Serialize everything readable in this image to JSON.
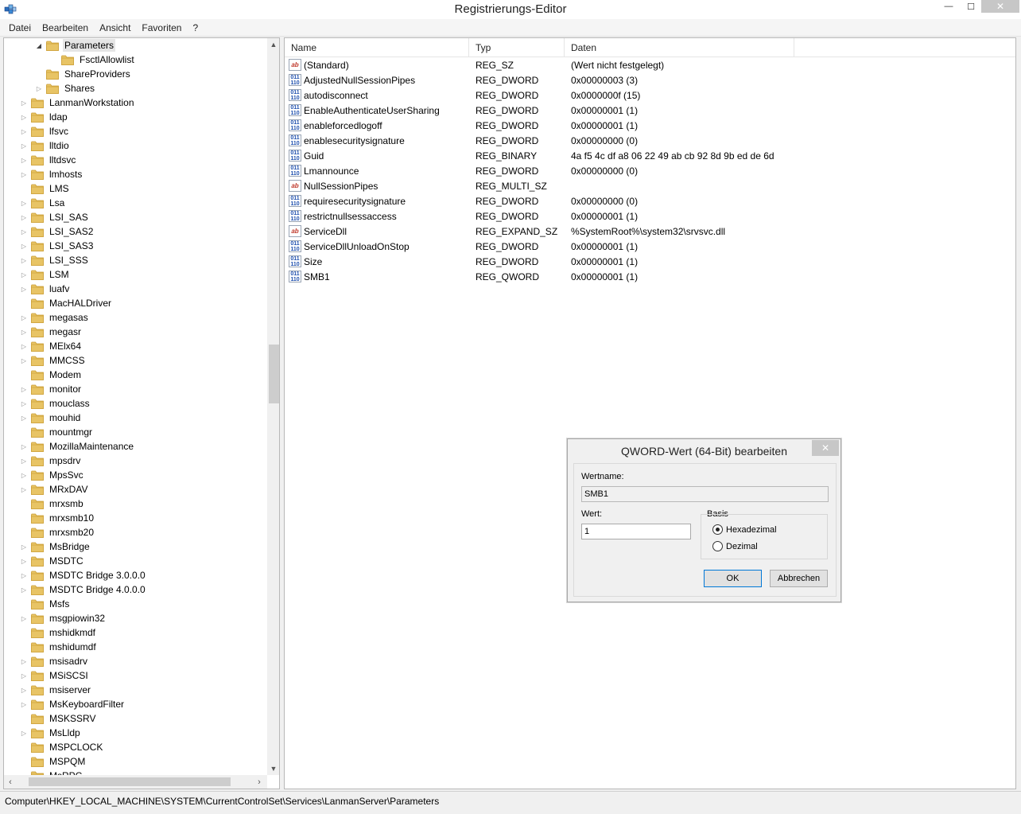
{
  "window": {
    "title": "Registrierungs-Editor",
    "minimize_glyph": "—",
    "maximize_glyph": "☐",
    "close_glyph": "✕"
  },
  "menu": [
    "Datei",
    "Bearbeiten",
    "Ansicht",
    "Favoriten",
    "?"
  ],
  "tree": {
    "items": [
      {
        "label": "Parameters",
        "indent": 2,
        "expander": "open",
        "selected": true
      },
      {
        "label": "FsctlAllowlist",
        "indent": 3,
        "expander": "none",
        "selected": false
      },
      {
        "label": "ShareProviders",
        "indent": 2,
        "expander": "none",
        "selected": false
      },
      {
        "label": "Shares",
        "indent": 2,
        "expander": "closed",
        "selected": false
      },
      {
        "label": "LanmanWorkstation",
        "indent": 1,
        "expander": "closed",
        "selected": false
      },
      {
        "label": "ldap",
        "indent": 1,
        "expander": "closed",
        "selected": false
      },
      {
        "label": "lfsvc",
        "indent": 1,
        "expander": "closed",
        "selected": false
      },
      {
        "label": "lltdio",
        "indent": 1,
        "expander": "closed",
        "selected": false
      },
      {
        "label": "lltdsvc",
        "indent": 1,
        "expander": "closed",
        "selected": false
      },
      {
        "label": "lmhosts",
        "indent": 1,
        "expander": "closed",
        "selected": false
      },
      {
        "label": "LMS",
        "indent": 1,
        "expander": "none",
        "selected": false
      },
      {
        "label": "Lsa",
        "indent": 1,
        "expander": "closed",
        "selected": false
      },
      {
        "label": "LSI_SAS",
        "indent": 1,
        "expander": "closed",
        "selected": false
      },
      {
        "label": "LSI_SAS2",
        "indent": 1,
        "expander": "closed",
        "selected": false
      },
      {
        "label": "LSI_SAS3",
        "indent": 1,
        "expander": "closed",
        "selected": false
      },
      {
        "label": "LSI_SSS",
        "indent": 1,
        "expander": "closed",
        "selected": false
      },
      {
        "label": "LSM",
        "indent": 1,
        "expander": "closed",
        "selected": false
      },
      {
        "label": "luafv",
        "indent": 1,
        "expander": "closed",
        "selected": false
      },
      {
        "label": "MacHALDriver",
        "indent": 1,
        "expander": "none",
        "selected": false
      },
      {
        "label": "megasas",
        "indent": 1,
        "expander": "closed",
        "selected": false
      },
      {
        "label": "megasr",
        "indent": 1,
        "expander": "closed",
        "selected": false
      },
      {
        "label": "MElx64",
        "indent": 1,
        "expander": "closed",
        "selected": false
      },
      {
        "label": "MMCSS",
        "indent": 1,
        "expander": "closed",
        "selected": false
      },
      {
        "label": "Modem",
        "indent": 1,
        "expander": "none",
        "selected": false
      },
      {
        "label": "monitor",
        "indent": 1,
        "expander": "closed",
        "selected": false
      },
      {
        "label": "mouclass",
        "indent": 1,
        "expander": "closed",
        "selected": false
      },
      {
        "label": "mouhid",
        "indent": 1,
        "expander": "closed",
        "selected": false
      },
      {
        "label": "mountmgr",
        "indent": 1,
        "expander": "none",
        "selected": false
      },
      {
        "label": "MozillaMaintenance",
        "indent": 1,
        "expander": "closed",
        "selected": false
      },
      {
        "label": "mpsdrv",
        "indent": 1,
        "expander": "closed",
        "selected": false
      },
      {
        "label": "MpsSvc",
        "indent": 1,
        "expander": "closed",
        "selected": false
      },
      {
        "label": "MRxDAV",
        "indent": 1,
        "expander": "closed",
        "selected": false
      },
      {
        "label": "mrxsmb",
        "indent": 1,
        "expander": "none",
        "selected": false
      },
      {
        "label": "mrxsmb10",
        "indent": 1,
        "expander": "none",
        "selected": false
      },
      {
        "label": "mrxsmb20",
        "indent": 1,
        "expander": "none",
        "selected": false
      },
      {
        "label": "MsBridge",
        "indent": 1,
        "expander": "closed",
        "selected": false
      },
      {
        "label": "MSDTC",
        "indent": 1,
        "expander": "closed",
        "selected": false
      },
      {
        "label": "MSDTC Bridge 3.0.0.0",
        "indent": 1,
        "expander": "closed",
        "selected": false
      },
      {
        "label": "MSDTC Bridge 4.0.0.0",
        "indent": 1,
        "expander": "closed",
        "selected": false
      },
      {
        "label": "Msfs",
        "indent": 1,
        "expander": "none",
        "selected": false
      },
      {
        "label": "msgpiowin32",
        "indent": 1,
        "expander": "closed",
        "selected": false
      },
      {
        "label": "mshidkmdf",
        "indent": 1,
        "expander": "none",
        "selected": false
      },
      {
        "label": "mshidumdf",
        "indent": 1,
        "expander": "none",
        "selected": false
      },
      {
        "label": "msisadrv",
        "indent": 1,
        "expander": "closed",
        "selected": false
      },
      {
        "label": "MSiSCSI",
        "indent": 1,
        "expander": "closed",
        "selected": false
      },
      {
        "label": "msiserver",
        "indent": 1,
        "expander": "closed",
        "selected": false
      },
      {
        "label": "MsKeyboardFilter",
        "indent": 1,
        "expander": "closed",
        "selected": false
      },
      {
        "label": "MSKSSRV",
        "indent": 1,
        "expander": "none",
        "selected": false
      },
      {
        "label": "MsLldp",
        "indent": 1,
        "expander": "closed",
        "selected": false
      },
      {
        "label": "MSPCLOCK",
        "indent": 1,
        "expander": "none",
        "selected": false
      },
      {
        "label": "MSPQM",
        "indent": 1,
        "expander": "none",
        "selected": false
      },
      {
        "label": "MsRPC",
        "indent": 1,
        "expander": "none",
        "selected": false
      }
    ],
    "scroll_up_glyph": "▲",
    "scroll_down_glyph": "▼",
    "scroll_left_glyph": "‹",
    "scroll_right_glyph": "›"
  },
  "list": {
    "columns": [
      "Name",
      "Typ",
      "Daten"
    ],
    "rows": [
      {
        "icon": "string-value-icon",
        "name": "(Standard)",
        "type": "REG_SZ",
        "data": "(Wert nicht festgelegt)"
      },
      {
        "icon": "binary-value-icon",
        "name": "AdjustedNullSessionPipes",
        "type": "REG_DWORD",
        "data": "0x00000003 (3)"
      },
      {
        "icon": "binary-value-icon",
        "name": "autodisconnect",
        "type": "REG_DWORD",
        "data": "0x0000000f (15)"
      },
      {
        "icon": "binary-value-icon",
        "name": "EnableAuthenticateUserSharing",
        "type": "REG_DWORD",
        "data": "0x00000001 (1)"
      },
      {
        "icon": "binary-value-icon",
        "name": "enableforcedlogoff",
        "type": "REG_DWORD",
        "data": "0x00000001 (1)"
      },
      {
        "icon": "binary-value-icon",
        "name": "enablesecuritysignature",
        "type": "REG_DWORD",
        "data": "0x00000000 (0)"
      },
      {
        "icon": "binary-value-icon",
        "name": "Guid",
        "type": "REG_BINARY",
        "data": "4a f5 4c df a8 06 22 49 ab cb 92 8d 9b ed de 6d"
      },
      {
        "icon": "binary-value-icon",
        "name": "Lmannounce",
        "type": "REG_DWORD",
        "data": "0x00000000 (0)"
      },
      {
        "icon": "string-value-icon",
        "name": "NullSessionPipes",
        "type": "REG_MULTI_SZ",
        "data": ""
      },
      {
        "icon": "binary-value-icon",
        "name": "requiresecuritysignature",
        "type": "REG_DWORD",
        "data": "0x00000000 (0)"
      },
      {
        "icon": "binary-value-icon",
        "name": "restrictnullsessaccess",
        "type": "REG_DWORD",
        "data": "0x00000001 (1)"
      },
      {
        "icon": "string-value-icon",
        "name": "ServiceDll",
        "type": "REG_EXPAND_SZ",
        "data": "%SystemRoot%\\system32\\srvsvc.dll"
      },
      {
        "icon": "binary-value-icon",
        "name": "ServiceDllUnloadOnStop",
        "type": "REG_DWORD",
        "data": "0x00000001 (1)"
      },
      {
        "icon": "binary-value-icon",
        "name": "Size",
        "type": "REG_DWORD",
        "data": "0x00000001 (1)"
      },
      {
        "icon": "binary-value-icon",
        "name": "SMB1",
        "type": "REG_QWORD",
        "data": "0x00000001 (1)"
      }
    ]
  },
  "status": {
    "path": "Computer\\HKEY_LOCAL_MACHINE\\SYSTEM\\CurrentControlSet\\Services\\LanmanServer\\Parameters"
  },
  "dialog": {
    "title": "QWORD-Wert (64-Bit) bearbeiten",
    "close_glyph": "✕",
    "name_label": "Wertname:",
    "name_value": "SMB1",
    "value_label": "Wert:",
    "value_value": "1",
    "base_label": "Basis",
    "hex_label": "Hexadezimal",
    "dec_label": "Dezimal",
    "selected_base": "hex",
    "ok_label": "OK",
    "cancel_label": "Abbrechen"
  },
  "colors": {
    "folder": "#e8c465",
    "folder_dark": "#c99a2e",
    "selection": "#e5e5e5",
    "string_icon_text": "#c0392b",
    "binary_icon_text": "#1e4fae"
  }
}
